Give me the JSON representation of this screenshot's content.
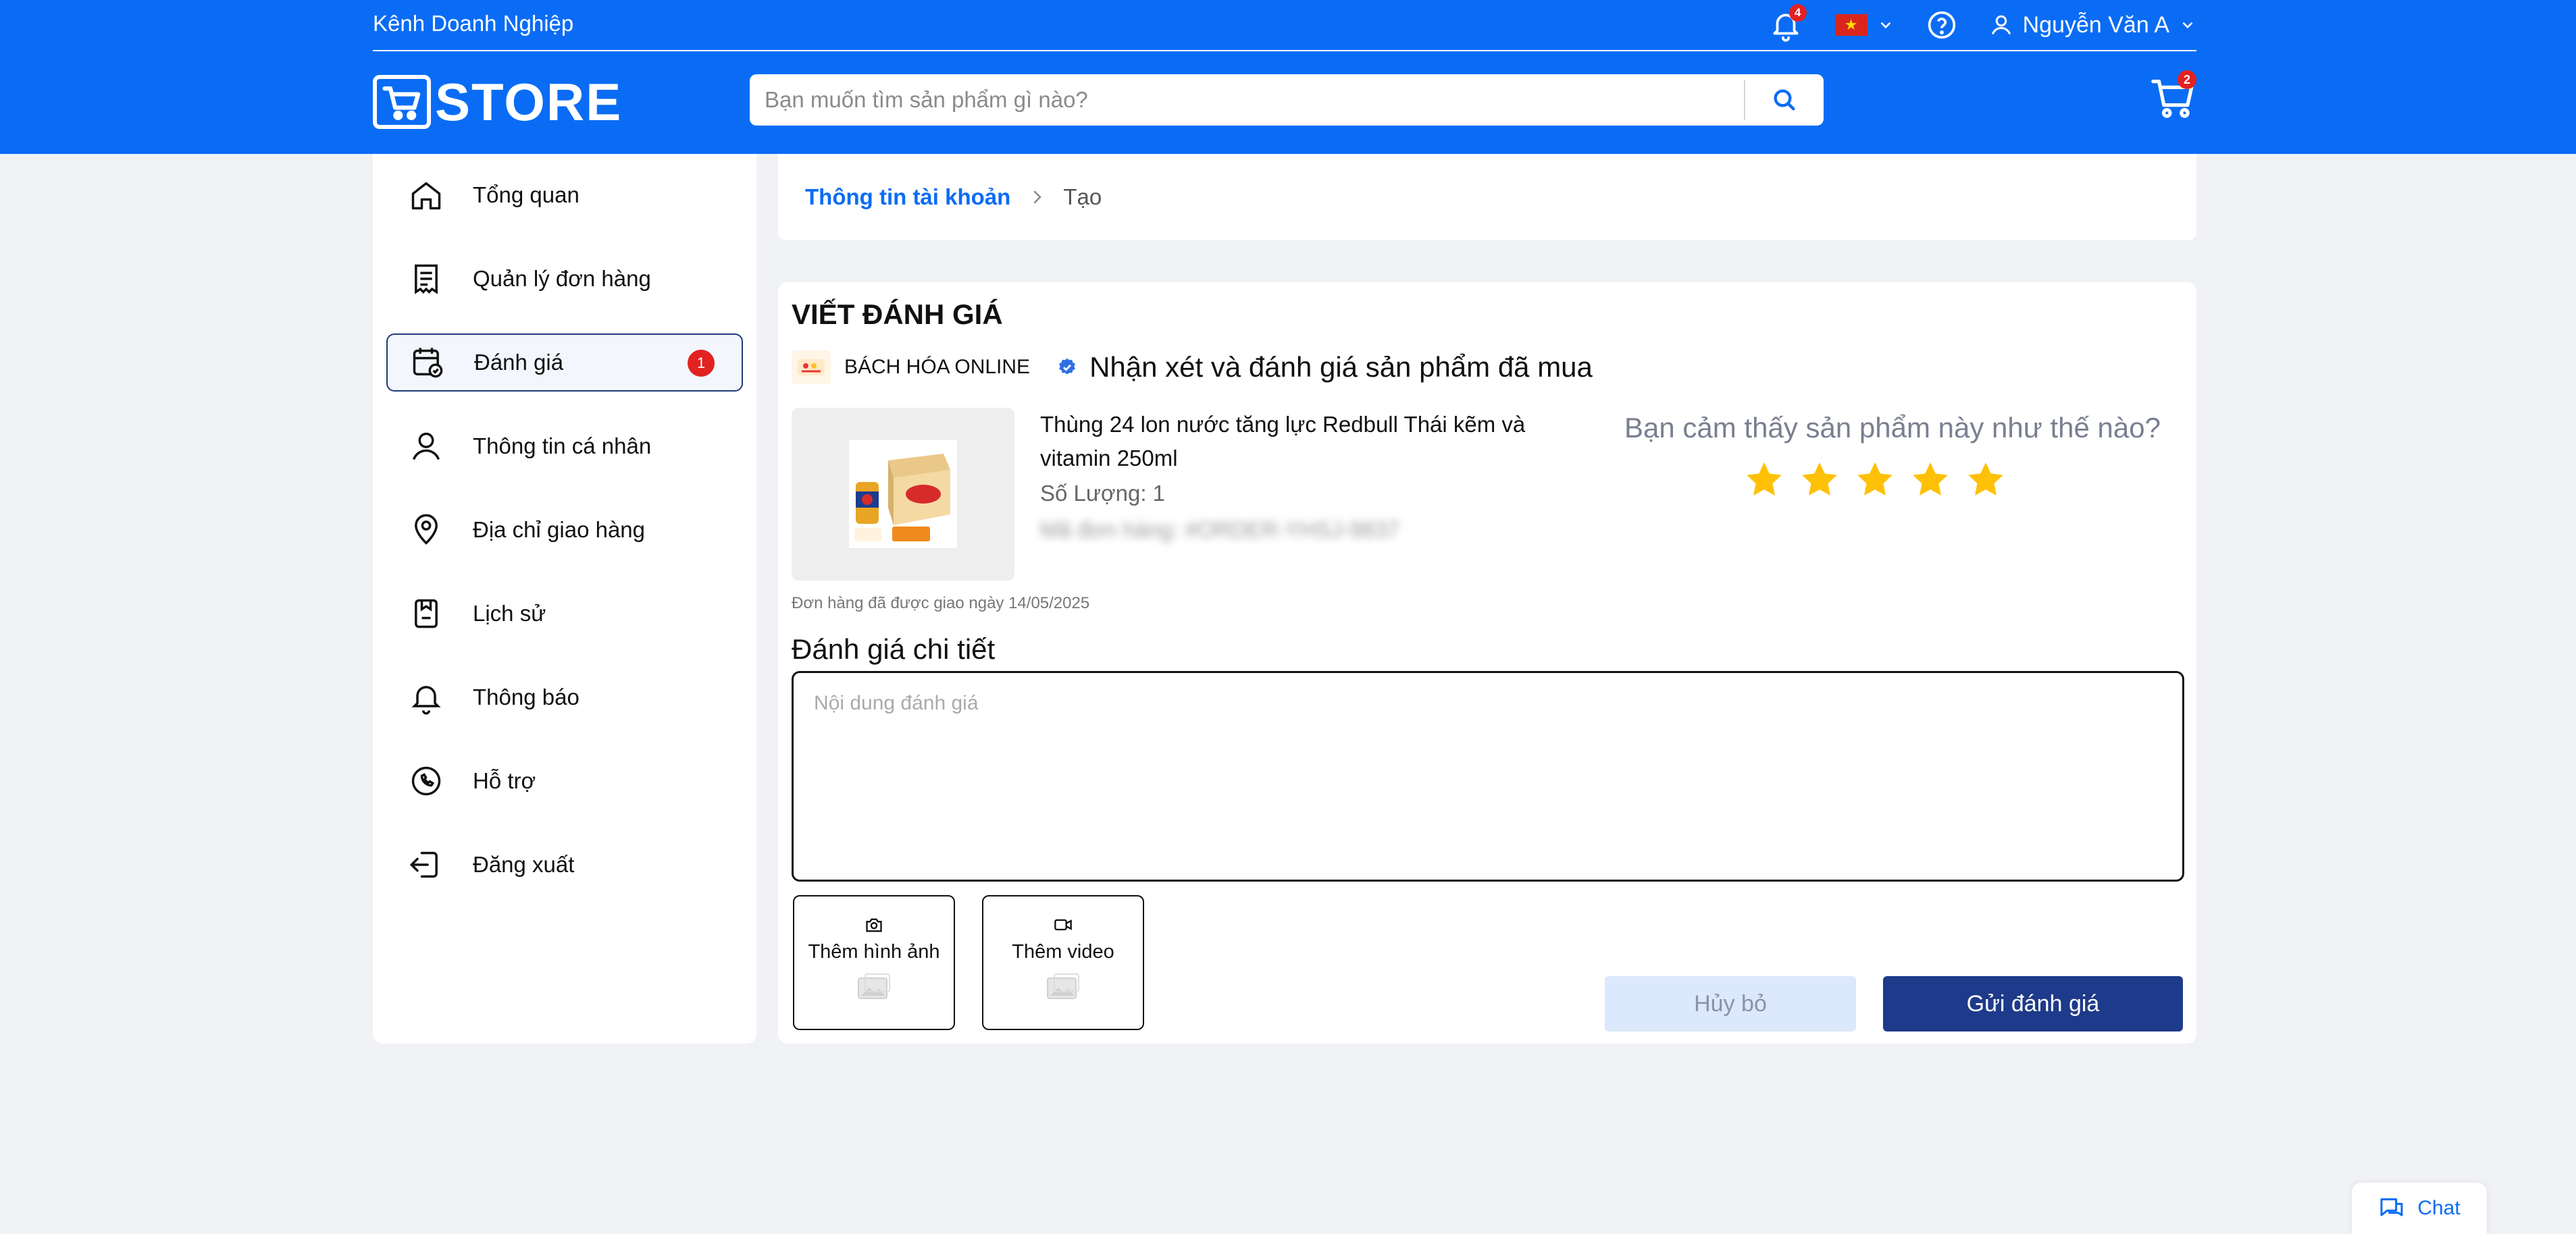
{
  "header": {
    "business_channel": "Kênh Doanh Nghiệp",
    "notification_count": "4",
    "language": "vi",
    "user_name": "Nguyễn Văn A",
    "logo_text": "STORE",
    "search_placeholder": "Bạn muốn tìm sản phẩm gì nào?",
    "cart_count": "2"
  },
  "sidebar": {
    "items": [
      {
        "label": "Tổng quan",
        "icon": "home-icon"
      },
      {
        "label": "Quản lý đơn hàng",
        "icon": "receipt-icon"
      },
      {
        "label": "Đánh giá",
        "icon": "review-icon",
        "active": true,
        "badge": "1"
      },
      {
        "label": "Thông tin cá nhân",
        "icon": "user-icon"
      },
      {
        "label": "Địa chỉ giao hàng",
        "icon": "location-icon"
      },
      {
        "label": "Lịch sử",
        "icon": "history-icon"
      },
      {
        "label": "Thông báo",
        "icon": "bell-icon"
      },
      {
        "label": "Hỗ trợ",
        "icon": "phone-icon"
      },
      {
        "label": "Đăng xuất",
        "icon": "logout-icon"
      }
    ]
  },
  "breadcrumb": {
    "parent": "Thông tin tài khoản",
    "current": "Tạo"
  },
  "review": {
    "title": "VIẾT ĐÁNH GIÁ",
    "shop_name": "BÁCH HÓA ONLINE",
    "verified_text": "Nhận xét và đánh giá sản phẩm đã mua",
    "product_name": "Thùng 24 lon nước tăng lực Redbull Thái kẽm và vitamin 250ml",
    "quantity": "Số Lượng: 1",
    "order_code": "Mã đơn hàng: #ORDER-YHSJ-9837",
    "delivered": "Đơn hàng đã được giao ngày 14/05/2025",
    "rating_question": "Bạn cảm thấy sản phẩm này như thế nào?",
    "rating": 5,
    "rating_max": 5,
    "detail_label": "Đánh giá chi tiết",
    "detail_placeholder": "Nội dung đánh giá",
    "detail_value": "",
    "add_image": "Thêm hình ảnh",
    "add_video": "Thêm video",
    "cancel": "Hủy bỏ",
    "submit": "Gửi đánh giá"
  },
  "chat": {
    "label": "Chat"
  },
  "colors": {
    "brand": "#0a6cf5",
    "primary_button": "#1e3a8a",
    "star": "#ffc107",
    "badge": "#e32121"
  }
}
